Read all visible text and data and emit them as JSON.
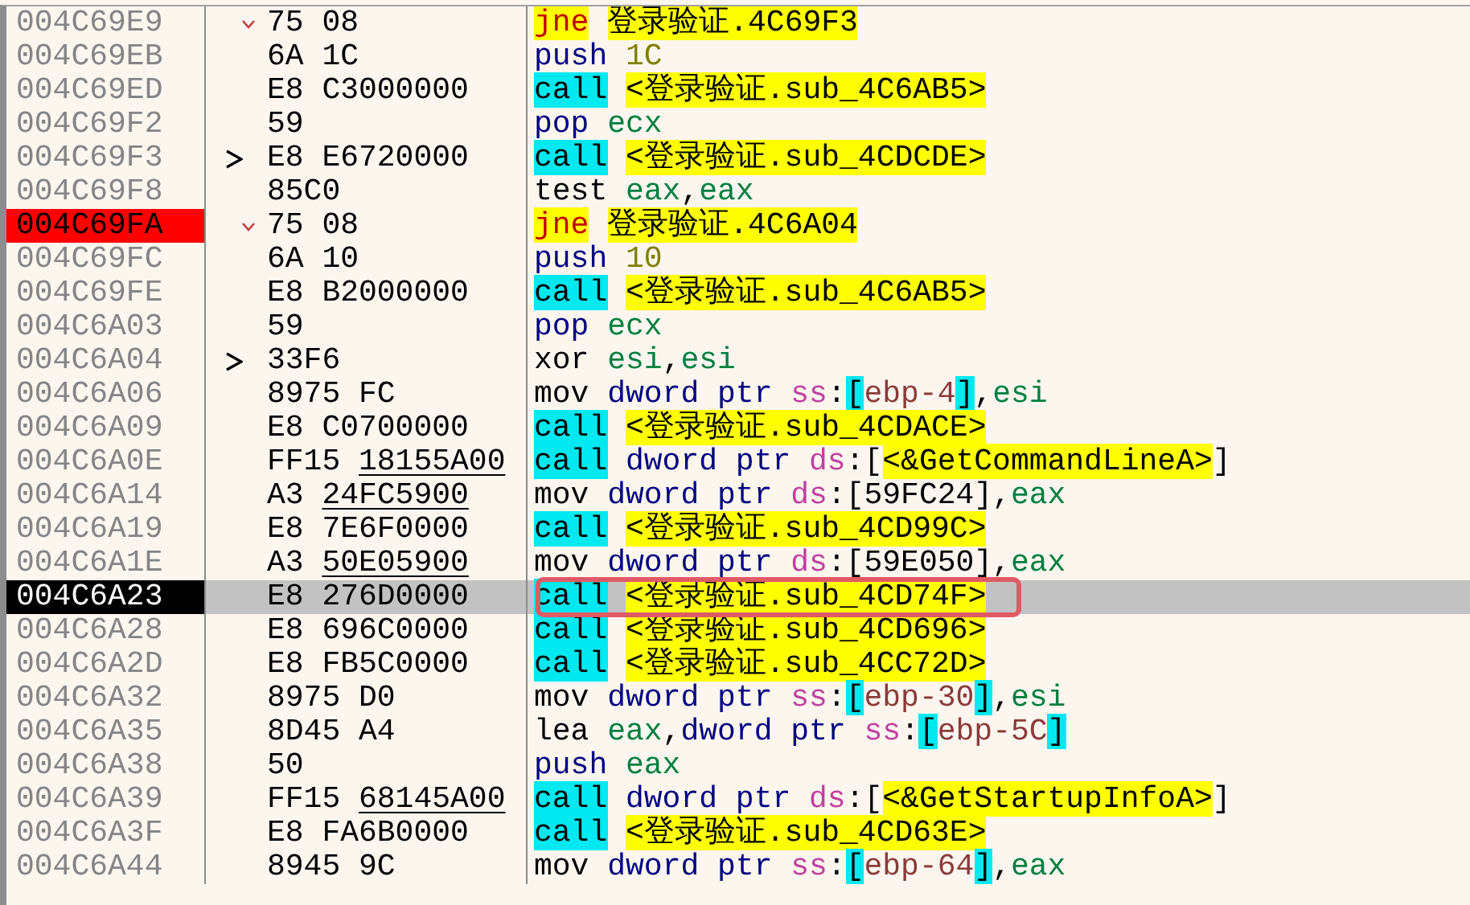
{
  "rows": [
    {
      "address": "004C69E9",
      "breakpoint": false,
      "current": false,
      "jump_arrow": true,
      "jump_target": false,
      "opcode": "75 08",
      "selected": false,
      "annotated": false,
      "ins": [
        {
          "t": "jne",
          "kind": "jmp"
        },
        {
          "t": "登录验证.4C69F3",
          "kind": "label",
          "space_before": true
        }
      ]
    },
    {
      "address": "004C69EB",
      "breakpoint": false,
      "current": false,
      "jump_arrow": false,
      "jump_target": false,
      "opcode": "6A 1C",
      "selected": false,
      "annotated": false,
      "ins": [
        {
          "t": "push",
          "kind": "stack"
        },
        {
          "t": "1C",
          "kind": "imm",
          "space_before": true
        }
      ]
    },
    {
      "address": "004C69ED",
      "breakpoint": false,
      "current": false,
      "jump_arrow": false,
      "jump_target": false,
      "opcode": "E8",
      "operand": "C3000000",
      "relocated": false,
      "selected": false,
      "annotated": false,
      "ins": [
        {
          "t": "call",
          "kind": "call"
        },
        {
          "t": "<登录验证.sub_4C6AB5>",
          "kind": "label",
          "space_before": true
        }
      ]
    },
    {
      "address": "004C69F2",
      "breakpoint": false,
      "current": false,
      "jump_arrow": false,
      "jump_target": false,
      "opcode": "59",
      "selected": false,
      "annotated": false,
      "ins": [
        {
          "t": "pop",
          "kind": "stack"
        },
        {
          "t": "ecx",
          "kind": "reg",
          "space_before": true
        }
      ]
    },
    {
      "address": "004C69F3",
      "breakpoint": false,
      "current": false,
      "jump_arrow": false,
      "jump_target": true,
      "opcode": "E8",
      "operand": "E6720000",
      "relocated": false,
      "selected": false,
      "annotated": false,
      "ins": [
        {
          "t": "call",
          "kind": "call"
        },
        {
          "t": "<登录验证.sub_4CDCDE>",
          "kind": "label",
          "space_before": true
        }
      ]
    },
    {
      "address": "004C69F8",
      "breakpoint": false,
      "current": false,
      "jump_arrow": false,
      "jump_target": false,
      "opcode": "85C0",
      "selected": false,
      "annotated": false,
      "ins": [
        {
          "t": "test",
          "kind": "plain"
        },
        {
          "t": "eax",
          "kind": "reg",
          "space_before": true
        },
        {
          "t": ",",
          "kind": "plain"
        },
        {
          "t": "eax",
          "kind": "reg"
        }
      ]
    },
    {
      "address": "004C69FA",
      "breakpoint": true,
      "current": false,
      "jump_arrow": true,
      "jump_target": false,
      "opcode": "75 08",
      "selected": false,
      "annotated": false,
      "ins": [
        {
          "t": "jne",
          "kind": "jmp"
        },
        {
          "t": "登录验证.4C6A04",
          "kind": "label",
          "space_before": true
        }
      ]
    },
    {
      "address": "004C69FC",
      "breakpoint": false,
      "current": false,
      "jump_arrow": false,
      "jump_target": false,
      "opcode": "6A 10",
      "selected": false,
      "annotated": false,
      "ins": [
        {
          "t": "push",
          "kind": "stack"
        },
        {
          "t": "10",
          "kind": "imm",
          "space_before": true
        }
      ]
    },
    {
      "address": "004C69FE",
      "breakpoint": false,
      "current": false,
      "jump_arrow": false,
      "jump_target": false,
      "opcode": "E8",
      "operand": "B2000000",
      "relocated": false,
      "selected": false,
      "annotated": false,
      "ins": [
        {
          "t": "call",
          "kind": "call"
        },
        {
          "t": "<登录验证.sub_4C6AB5>",
          "kind": "label",
          "space_before": true
        }
      ]
    },
    {
      "address": "004C6A03",
      "breakpoint": false,
      "current": false,
      "jump_arrow": false,
      "jump_target": false,
      "opcode": "59",
      "selected": false,
      "annotated": false,
      "ins": [
        {
          "t": "pop",
          "kind": "stack"
        },
        {
          "t": "ecx",
          "kind": "reg",
          "space_before": true
        }
      ]
    },
    {
      "address": "004C6A04",
      "breakpoint": false,
      "current": false,
      "jump_arrow": false,
      "jump_target": true,
      "opcode": "33F6",
      "selected": false,
      "annotated": false,
      "ins": [
        {
          "t": "xor",
          "kind": "plain"
        },
        {
          "t": "esi",
          "kind": "reg",
          "space_before": true
        },
        {
          "t": ",",
          "kind": "plain"
        },
        {
          "t": "esi",
          "kind": "reg"
        }
      ]
    },
    {
      "address": "004C6A06",
      "breakpoint": false,
      "current": false,
      "jump_arrow": false,
      "jump_target": false,
      "opcode": "8975 FC",
      "selected": false,
      "annotated": false,
      "ins": [
        {
          "t": "mov",
          "kind": "plain"
        },
        {
          "t": "dword ptr",
          "kind": "size",
          "space_before": true
        },
        {
          "t": "ss",
          "kind": "seg",
          "space_before": true
        },
        {
          "t": ":",
          "kind": "plain"
        },
        {
          "t": "[",
          "kind": "bracket"
        },
        {
          "t": "ebp-4",
          "kind": "mem"
        },
        {
          "t": "]",
          "kind": "bracket"
        },
        {
          "t": ",",
          "kind": "plain"
        },
        {
          "t": "esi",
          "kind": "reg"
        }
      ]
    },
    {
      "address": "004C6A09",
      "breakpoint": false,
      "current": false,
      "jump_arrow": false,
      "jump_target": false,
      "opcode": "E8",
      "operand": "C0700000",
      "relocated": false,
      "selected": false,
      "annotated": false,
      "ins": [
        {
          "t": "call",
          "kind": "call"
        },
        {
          "t": "<登录验证.sub_4CDACE>",
          "kind": "label",
          "space_before": true
        }
      ]
    },
    {
      "address": "004C6A0E",
      "breakpoint": false,
      "current": false,
      "jump_arrow": false,
      "jump_target": false,
      "opcode": "FF15",
      "operand": "18155A00",
      "relocated": true,
      "selected": false,
      "annotated": false,
      "ins": [
        {
          "t": "call",
          "kind": "call"
        },
        {
          "t": "dword ptr",
          "kind": "size",
          "space_before": true
        },
        {
          "t": "ds",
          "kind": "seg",
          "space_before": true
        },
        {
          "t": ":[",
          "kind": "plain"
        },
        {
          "t": "<&GetCommandLineA>",
          "kind": "label"
        },
        {
          "t": "]",
          "kind": "plain"
        }
      ]
    },
    {
      "address": "004C6A14",
      "breakpoint": false,
      "current": false,
      "jump_arrow": false,
      "jump_target": false,
      "opcode": "A3",
      "operand": "24FC5900",
      "relocated": true,
      "selected": false,
      "annotated": false,
      "ins": [
        {
          "t": "mov",
          "kind": "plain"
        },
        {
          "t": "dword ptr",
          "kind": "size",
          "space_before": true
        },
        {
          "t": "ds",
          "kind": "seg",
          "space_before": true
        },
        {
          "t": ":[59FC24],",
          "kind": "plain"
        },
        {
          "t": "eax",
          "kind": "reg"
        }
      ]
    },
    {
      "address": "004C6A19",
      "breakpoint": false,
      "current": false,
      "jump_arrow": false,
      "jump_target": false,
      "opcode": "E8",
      "operand": "7E6F0000",
      "relocated": false,
      "selected": false,
      "annotated": false,
      "ins": [
        {
          "t": "call",
          "kind": "call"
        },
        {
          "t": "<登录验证.sub_4CD99C>",
          "kind": "label",
          "space_before": true
        }
      ]
    },
    {
      "address": "004C6A1E",
      "breakpoint": false,
      "current": false,
      "jump_arrow": false,
      "jump_target": false,
      "opcode": "A3",
      "operand": "50E05900",
      "relocated": true,
      "selected": false,
      "annotated": false,
      "ins": [
        {
          "t": "mov",
          "kind": "plain"
        },
        {
          "t": "dword ptr",
          "kind": "size",
          "space_before": true
        },
        {
          "t": "ds",
          "kind": "seg",
          "space_before": true
        },
        {
          "t": ":[59E050],",
          "kind": "plain"
        },
        {
          "t": "eax",
          "kind": "reg"
        }
      ]
    },
    {
      "address": "004C6A23",
      "breakpoint": false,
      "current": true,
      "jump_arrow": false,
      "jump_target": false,
      "opcode": "E8",
      "operand": "276D0000",
      "relocated": false,
      "selected": true,
      "annotated": true,
      "ins": [
        {
          "t": "call",
          "kind": "call"
        },
        {
          "t": "<登录验证.sub_4CD74F>",
          "kind": "label",
          "space_before": true
        }
      ]
    },
    {
      "address": "004C6A28",
      "breakpoint": false,
      "current": false,
      "jump_arrow": false,
      "jump_target": false,
      "opcode": "E8",
      "operand": "696C0000",
      "relocated": false,
      "selected": false,
      "annotated": false,
      "ins": [
        {
          "t": "call",
          "kind": "call"
        },
        {
          "t": "<登录验证.sub_4CD696>",
          "kind": "label",
          "space_before": true
        }
      ]
    },
    {
      "address": "004C6A2D",
      "breakpoint": false,
      "current": false,
      "jump_arrow": false,
      "jump_target": false,
      "opcode": "E8",
      "operand": "FB5C0000",
      "relocated": false,
      "selected": false,
      "annotated": false,
      "ins": [
        {
          "t": "call",
          "kind": "call"
        },
        {
          "t": "<登录验证.sub_4CC72D>",
          "kind": "label",
          "space_before": true
        }
      ]
    },
    {
      "address": "004C6A32",
      "breakpoint": false,
      "current": false,
      "jump_arrow": false,
      "jump_target": false,
      "opcode": "8975 D0",
      "selected": false,
      "annotated": false,
      "ins": [
        {
          "t": "mov",
          "kind": "plain"
        },
        {
          "t": "dword ptr",
          "kind": "size",
          "space_before": true
        },
        {
          "t": "ss",
          "kind": "seg",
          "space_before": true
        },
        {
          "t": ":",
          "kind": "plain"
        },
        {
          "t": "[",
          "kind": "bracket"
        },
        {
          "t": "ebp-30",
          "kind": "mem"
        },
        {
          "t": "]",
          "kind": "bracket"
        },
        {
          "t": ",",
          "kind": "plain"
        },
        {
          "t": "esi",
          "kind": "reg"
        }
      ]
    },
    {
      "address": "004C6A35",
      "breakpoint": false,
      "current": false,
      "jump_arrow": false,
      "jump_target": false,
      "opcode": "8D45 A4",
      "selected": false,
      "annotated": false,
      "ins": [
        {
          "t": "lea",
          "kind": "plain"
        },
        {
          "t": "eax",
          "kind": "reg",
          "space_before": true
        },
        {
          "t": ",",
          "kind": "plain"
        },
        {
          "t": "dword ptr",
          "kind": "size"
        },
        {
          "t": "ss",
          "kind": "seg",
          "space_before": true
        },
        {
          "t": ":",
          "kind": "plain"
        },
        {
          "t": "[",
          "kind": "bracket"
        },
        {
          "t": "ebp-5C",
          "kind": "mem"
        },
        {
          "t": "]",
          "kind": "bracket"
        }
      ]
    },
    {
      "address": "004C6A38",
      "breakpoint": false,
      "current": false,
      "jump_arrow": false,
      "jump_target": false,
      "opcode": "50",
      "selected": false,
      "annotated": false,
      "ins": [
        {
          "t": "push",
          "kind": "stack"
        },
        {
          "t": "eax",
          "kind": "reg",
          "space_before": true
        }
      ]
    },
    {
      "address": "004C6A39",
      "breakpoint": false,
      "current": false,
      "jump_arrow": false,
      "jump_target": false,
      "opcode": "FF15",
      "operand": "68145A00",
      "relocated": true,
      "selected": false,
      "annotated": false,
      "ins": [
        {
          "t": "call",
          "kind": "call"
        },
        {
          "t": "dword ptr",
          "kind": "size",
          "space_before": true
        },
        {
          "t": "ds",
          "kind": "seg",
          "space_before": true
        },
        {
          "t": ":[",
          "kind": "plain"
        },
        {
          "t": "<&GetStartupInfoA>",
          "kind": "label"
        },
        {
          "t": "]",
          "kind": "plain"
        }
      ]
    },
    {
      "address": "004C6A3F",
      "breakpoint": false,
      "current": false,
      "jump_arrow": false,
      "jump_target": false,
      "opcode": "E8",
      "operand": "FA6B0000",
      "relocated": false,
      "selected": false,
      "annotated": false,
      "ins": [
        {
          "t": "call",
          "kind": "call"
        },
        {
          "t": "<登录验证.sub_4CD63E>",
          "kind": "label",
          "space_before": true
        }
      ]
    },
    {
      "address": "004C6A44",
      "breakpoint": false,
      "current": false,
      "jump_arrow": false,
      "jump_target": false,
      "opcode": "8945 9C",
      "selected": false,
      "annotated": false,
      "ins": [
        {
          "t": "mov",
          "kind": "plain"
        },
        {
          "t": "dword ptr",
          "kind": "size",
          "space_before": true
        },
        {
          "t": "ss",
          "kind": "seg",
          "space_before": true
        },
        {
          "t": ":",
          "kind": "plain"
        },
        {
          "t": "[",
          "kind": "bracket"
        },
        {
          "t": "ebp-64",
          "kind": "mem"
        },
        {
          "t": "]",
          "kind": "bracket"
        },
        {
          "t": ",",
          "kind": "plain"
        },
        {
          "t": "eax",
          "kind": "reg"
        }
      ]
    }
  ]
}
